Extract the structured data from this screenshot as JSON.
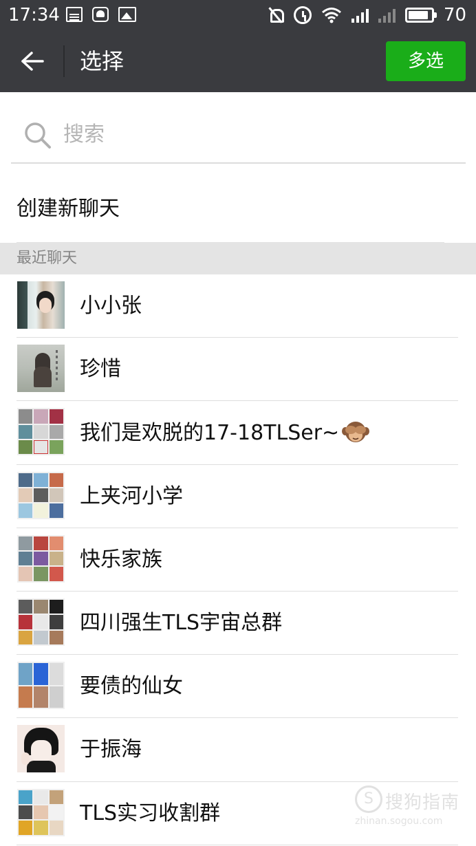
{
  "status_bar": {
    "time": "17:34",
    "battery_pct": "70",
    "icons": [
      "news-icon",
      "notification-icon",
      "image-icon",
      "mute-icon",
      "alarm-icon",
      "wifi-icon",
      "signal-icon",
      "signal-weak-icon",
      "battery-icon"
    ]
  },
  "header": {
    "title": "选择",
    "multi_select_label": "多选",
    "accent_color": "#1aad19",
    "bar_color": "#3a3b3f"
  },
  "search": {
    "placeholder": "搜索"
  },
  "create_new_chat": "创建新聊天",
  "recent_section_label": "最近聊天",
  "chats": [
    {
      "name": "小小张",
      "avatar": "photo"
    },
    {
      "name": "珍惜",
      "avatar": "photo"
    },
    {
      "name": "我们是欢脱的17-18TLSer~",
      "avatar": "group",
      "suffix_emoji": "see-no-evil-monkey"
    },
    {
      "name": "上夹河小学",
      "avatar": "group"
    },
    {
      "name": "快乐家族",
      "avatar": "group"
    },
    {
      "name": "四川强生TLS宇宙总群",
      "avatar": "group"
    },
    {
      "name": "要债的仙女",
      "avatar": "group"
    },
    {
      "name": "于振海",
      "avatar": "photo"
    },
    {
      "name": "TLS实习收割群",
      "avatar": "group"
    }
  ],
  "watermark": {
    "text": "搜狗指南",
    "url": "zhinan.sogou.com"
  }
}
